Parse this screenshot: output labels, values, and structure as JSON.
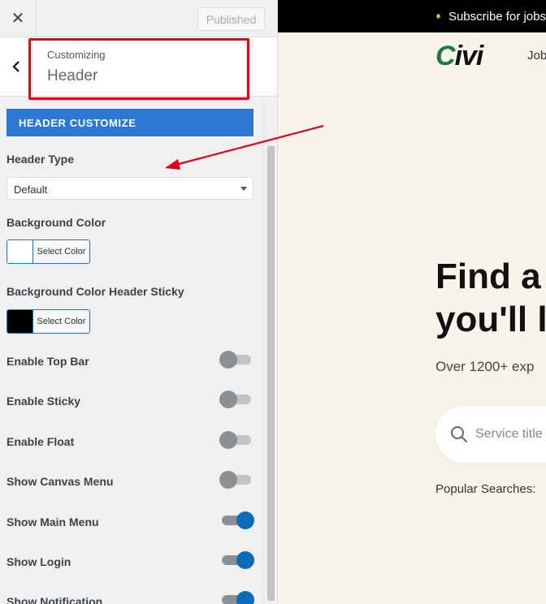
{
  "topbar": {
    "close_icon": "close-icon",
    "publish_label": "Published"
  },
  "section": {
    "sub": "Customizing",
    "title": "Header"
  },
  "banner": "HEADER CUSTOMIZE",
  "header_type": {
    "label": "Header Type",
    "value": "Default"
  },
  "bg_color": {
    "label": "Background Color",
    "button": "Select Color",
    "swatch": "#ffffff"
  },
  "bg_sticky": {
    "label": "Background Color Header Sticky",
    "button": "Select Color",
    "swatch": "#000000"
  },
  "toggles": [
    {
      "label": "Enable Top Bar",
      "on": false
    },
    {
      "label": "Enable Sticky",
      "on": false
    },
    {
      "label": "Enable Float",
      "on": false
    },
    {
      "label": "Show Canvas Menu",
      "on": false
    },
    {
      "label": "Show Main Menu",
      "on": true
    },
    {
      "label": "Show Login",
      "on": true
    },
    {
      "label": "Show Notification",
      "on": true
    }
  ],
  "preview": {
    "topbar_text": "Subscribe for jobs",
    "logo": "Civi",
    "nav_item": "Jobs",
    "hero_line1": "Find a",
    "hero_line2": "you'll l",
    "hero_sub": "Over 1200+ exp",
    "search_placeholder": "Service title",
    "popular": "Popular Searches:"
  },
  "colors": {
    "accent": "#2c78d4",
    "toggle_on": "#0a6cb6",
    "annotation": "#e3001b"
  }
}
